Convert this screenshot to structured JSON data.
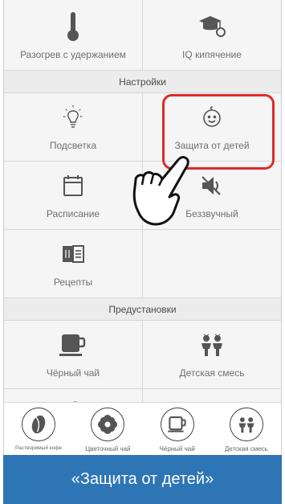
{
  "grid_top": {
    "items": [
      {
        "label": "Разогрев с удержанием",
        "icon": "thermometer-icon"
      },
      {
        "label": "IQ кипячение",
        "icon": "graduation-cap-icon"
      }
    ]
  },
  "settings": {
    "header": "Настройки",
    "items": [
      {
        "label": "Подсветка",
        "icon": "lightbulb-icon"
      },
      {
        "label": "Защита от детей",
        "icon": "child-face-icon"
      },
      {
        "label": "Расписание",
        "icon": "calendar-icon"
      },
      {
        "label": "Беззвучный",
        "icon": "mute-speaker-icon"
      },
      {
        "label": "Рецепты",
        "icon": "recipe-book-icon"
      }
    ]
  },
  "presets": {
    "header": "Предустановки",
    "items": [
      {
        "label": "Чёрный чай",
        "icon": "tea-cup-icon"
      },
      {
        "label": "Детская смесь",
        "icon": "children-icon"
      },
      {
        "label": "",
        "icon": "coffee-bean-icon"
      },
      {
        "label": "",
        "icon": "leaves-icon"
      }
    ]
  },
  "dock": {
    "items": [
      {
        "label": "Растворимый кофе",
        "icon": "coffee-bean-icon"
      },
      {
        "label": "Цветочный чай",
        "icon": "flower-icon"
      },
      {
        "label": "Чёрный чай",
        "icon": "tea-cup-icon"
      },
      {
        "label": "Детская смесь",
        "icon": "children-icon"
      }
    ]
  },
  "caption": {
    "text": "«Защита от детей»",
    "background": "#2e75b6"
  },
  "colors": {
    "highlight": "#e02a2a",
    "icon": "#555555"
  }
}
